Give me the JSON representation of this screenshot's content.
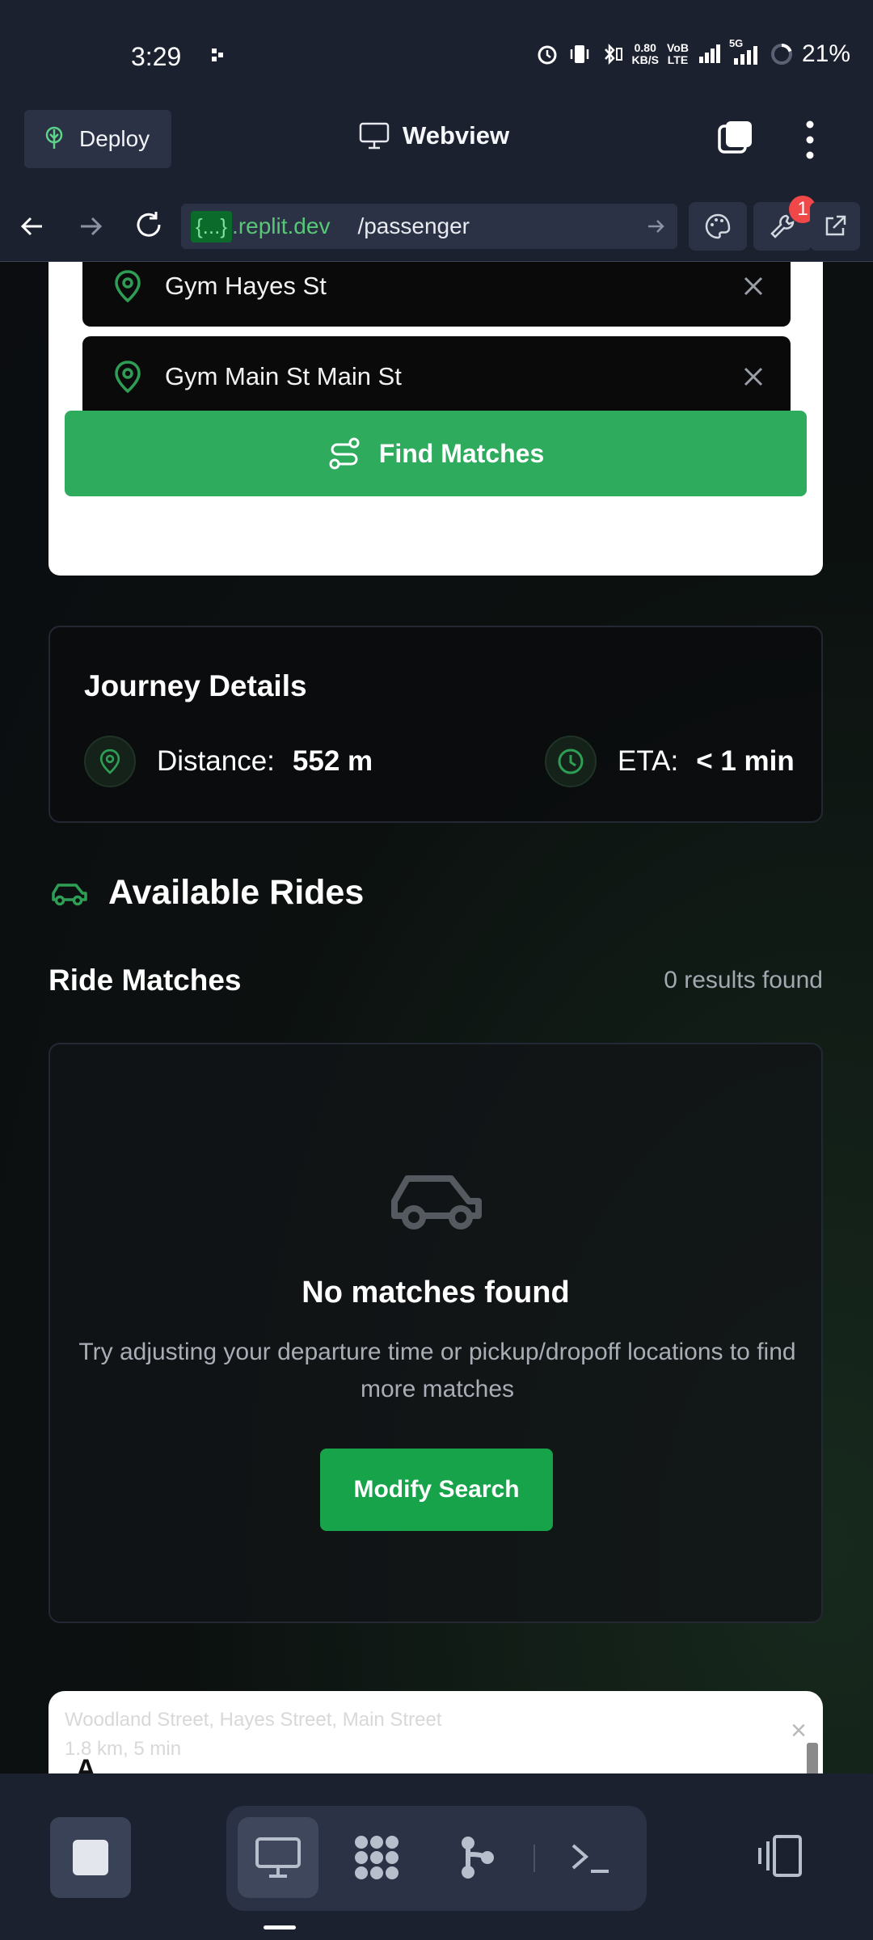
{
  "status_bar": {
    "time": "3:29",
    "net_speed_value": "0.80",
    "net_speed_unit": "KB/S",
    "volte_top": "VoB",
    "volte_bottom": "LTE",
    "signal2_label": "5G",
    "battery": "21%"
  },
  "replit": {
    "deploy_label": "Deploy",
    "webview_label": "Webview",
    "url_badge": "{...}",
    "url_domain": ".replit.dev",
    "url_path": "/passenger",
    "notification_count": "1"
  },
  "search": {
    "pickup": "Gym Hayes St",
    "dropoff": "Gym Main St Main St",
    "find_button": "Find Matches"
  },
  "journey": {
    "title": "Journey Details",
    "distance_label": "Distance:",
    "distance_value": "552 m",
    "eta_label": "ETA:",
    "eta_value": "< 1 min"
  },
  "rides": {
    "section_title": "Available Rides",
    "matches_title": "Ride Matches",
    "results_count": "0 results found",
    "empty_title": "No matches found",
    "empty_description": "Try adjusting your departure time or pickup/dropoff locations to find more matches",
    "modify_button": "Modify Search"
  },
  "map_card": {
    "faint_line1": "Woodland Street, Hayes Street, Main Street",
    "faint_line2": "1.8 km, 5 min",
    "letter": "A",
    "close_glyph": "×"
  },
  "colors": {
    "accent_green": "#2eab5d",
    "button_green": "#16a34a",
    "icon_green": "#2f9e55",
    "replit_bg": "#1c2130"
  }
}
